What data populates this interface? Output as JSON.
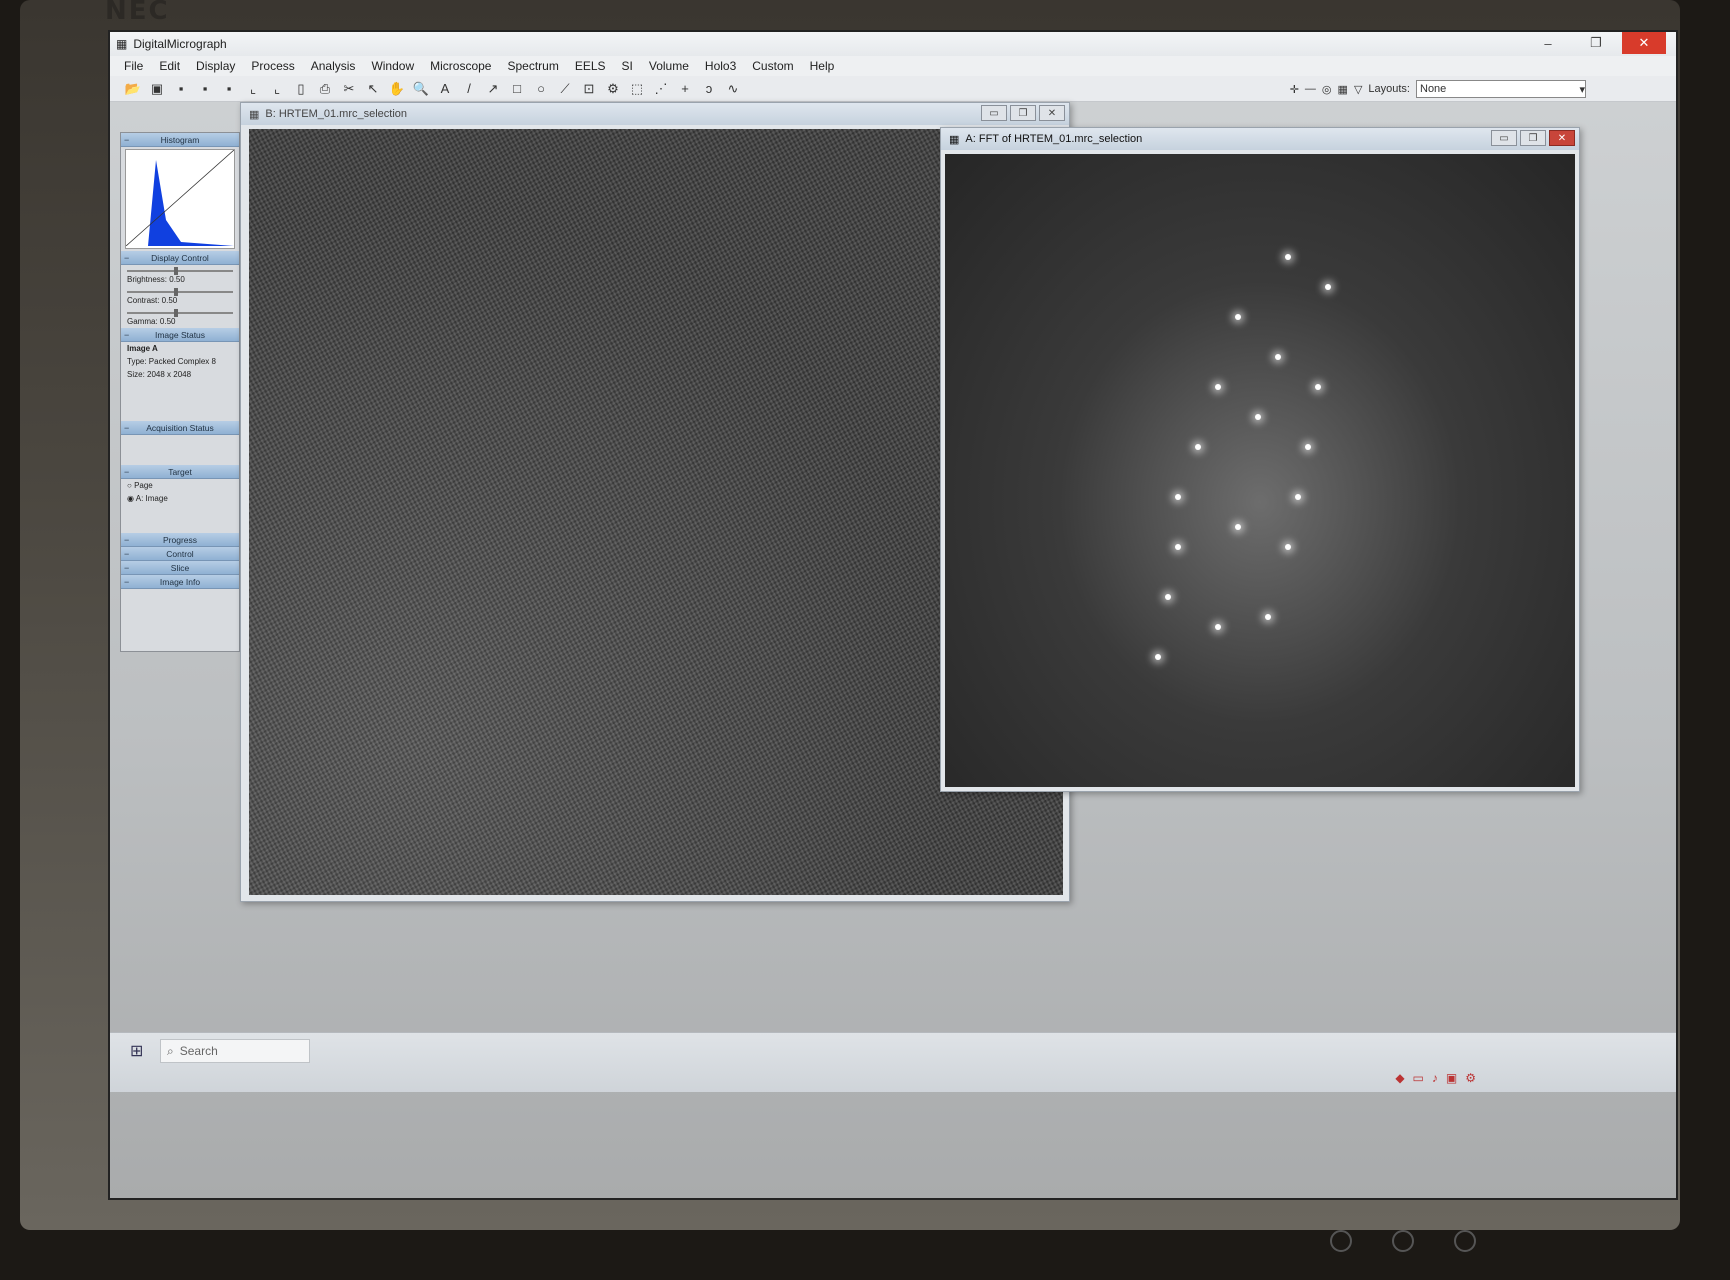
{
  "monitor": {
    "brand": "NEC"
  },
  "app": {
    "title": "DigitalMicrograph",
    "window_controls": {
      "minimize": "–",
      "restore": "❐",
      "close": "✕"
    }
  },
  "menu": [
    "File",
    "Edit",
    "Display",
    "Process",
    "Analysis",
    "Window",
    "Microscope",
    "Spectrum",
    "EELS",
    "SI",
    "Volume",
    "Holo3",
    "Custom",
    "Help"
  ],
  "layouts": {
    "label": "Layouts:",
    "value": "None"
  },
  "floating_panel": {
    "histogram_header": "Histogram",
    "display_control_header": "Display Control",
    "brightness": "Brightness: 0.50",
    "contrast": "Contrast: 0.50",
    "gamma": "Gamma: 0.50",
    "image_status_header": "Image Status",
    "image_name": "Image A",
    "image_type": "Type: Packed Complex 8",
    "image_size": "Size: 2048 x 2048",
    "acquisition_header": "Acquisition Status",
    "target_header": "Target",
    "target_page": "Page",
    "target_image": "A: Image",
    "progress_header": "Progress",
    "control_header": "Control",
    "slice_header": "Slice",
    "imageinfo_header": "Image Info"
  },
  "windows": {
    "hrtem": {
      "title": "B: HRTEM_01.mrc_selection"
    },
    "fft": {
      "title": "A: FFT of HRTEM_01.mrc_selection"
    }
  },
  "taskbar": {
    "search_placeholder": "Search"
  }
}
